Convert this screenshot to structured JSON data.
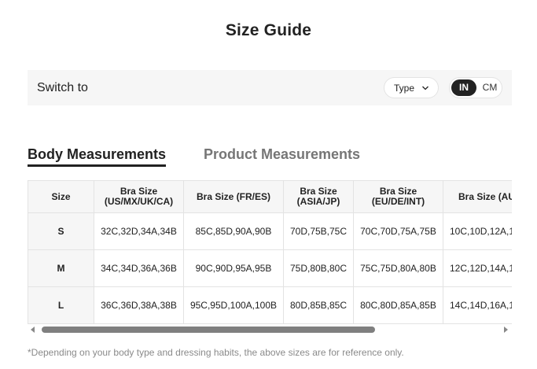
{
  "page": {
    "title": "Size Guide"
  },
  "switch_bar": {
    "label": "Switch to",
    "type_dropdown": {
      "label": "Type",
      "icon": "chevron-down-icon"
    },
    "unit_toggle": {
      "in": "IN",
      "cm": "CM",
      "selected": "IN"
    }
  },
  "tabs": [
    {
      "label": "Body Measurements",
      "active": true
    },
    {
      "label": "Product Measurements",
      "active": false
    }
  ],
  "table": {
    "headers": [
      "Size",
      "Bra Size (US/MX/UK/CA)",
      "Bra Size (FR/ES)",
      "Bra Size (ASIA/JP)",
      "Bra Size (EU/DE/INT)",
      "Bra Size (AU"
    ],
    "rows": [
      [
        "S",
        "32C,32D,34A,34B",
        "85C,85D,90A,90B",
        "70D,75B,75C",
        "70C,70D,75A,75B",
        "10C,10D,12A,1"
      ],
      [
        "M",
        "34C,34D,36A,36B",
        "90C,90D,95A,95B",
        "75D,80B,80C",
        "75C,75D,80A,80B",
        "12C,12D,14A,1"
      ],
      [
        "L",
        "36C,36D,38A,38B",
        "95C,95D,100A,100B",
        "80D,85B,85C",
        "80C,80D,85A,85B",
        "14C,14D,16A,1"
      ]
    ]
  },
  "scrollbar": {
    "visible_fraction": 0.73,
    "position": 0
  },
  "footnote": "*Depending on your body type and dressing habits, the above sizes are for reference only.",
  "colors": {
    "accent": "#222222",
    "inactive_tab": "#767676",
    "bar_bg": "#f6f6f6",
    "border": "#e3e3e3"
  }
}
